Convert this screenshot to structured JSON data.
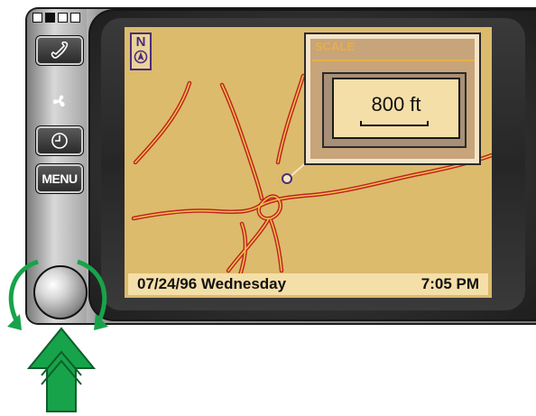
{
  "buttons": {
    "phone_icon": "phone-icon",
    "fan_icon": "fan-icon",
    "clock_icon": "clock-icon",
    "menu_label": "MENU"
  },
  "map": {
    "north_label": "N",
    "scale": {
      "title": "SCALE",
      "value": "800 ft"
    }
  },
  "status": {
    "date": "07/24/96 Wednesday",
    "time": "7:05 PM"
  },
  "colors": {
    "map_background": "#dcbb6d",
    "road_outline": "#c0221f",
    "road_fill": "#f2c14a",
    "rotate_arrow": "#17a34a",
    "push_arrow": "#17a34a"
  }
}
